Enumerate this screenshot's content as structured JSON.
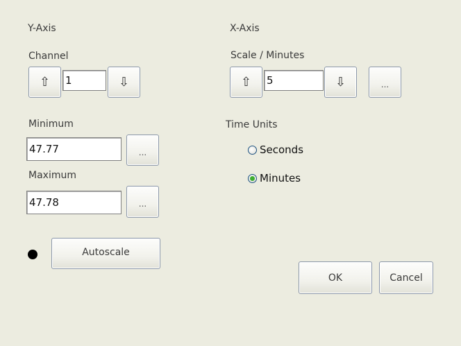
{
  "y_axis": {
    "heading": "Y-Axis",
    "channel_label": "Channel",
    "channel_up_glyph": "⇧",
    "channel_value": "1",
    "channel_down_glyph": "⇩",
    "minimum_label": "Minimum",
    "minimum_value": "47.77",
    "maximum_label": "Maximum",
    "maximum_value": "47.78",
    "ellipsis": "...",
    "autoscale_label": "Autoscale"
  },
  "x_axis": {
    "heading": "X-Axis",
    "scale_label": "Scale / Minutes",
    "scale_up_glyph": "⇧",
    "scale_value": "5",
    "scale_down_glyph": "⇩",
    "ellipsis": "..."
  },
  "time_units": {
    "label": "Time Units",
    "options": [
      {
        "label": "Seconds",
        "selected": false
      },
      {
        "label": "Minutes",
        "selected": true
      }
    ]
  },
  "dialog": {
    "ok_label": "OK",
    "cancel_label": "Cancel"
  },
  "colors": {
    "background": "#ecece0",
    "radio_selected": "#3fae32",
    "indicator_dot": "#000000"
  }
}
